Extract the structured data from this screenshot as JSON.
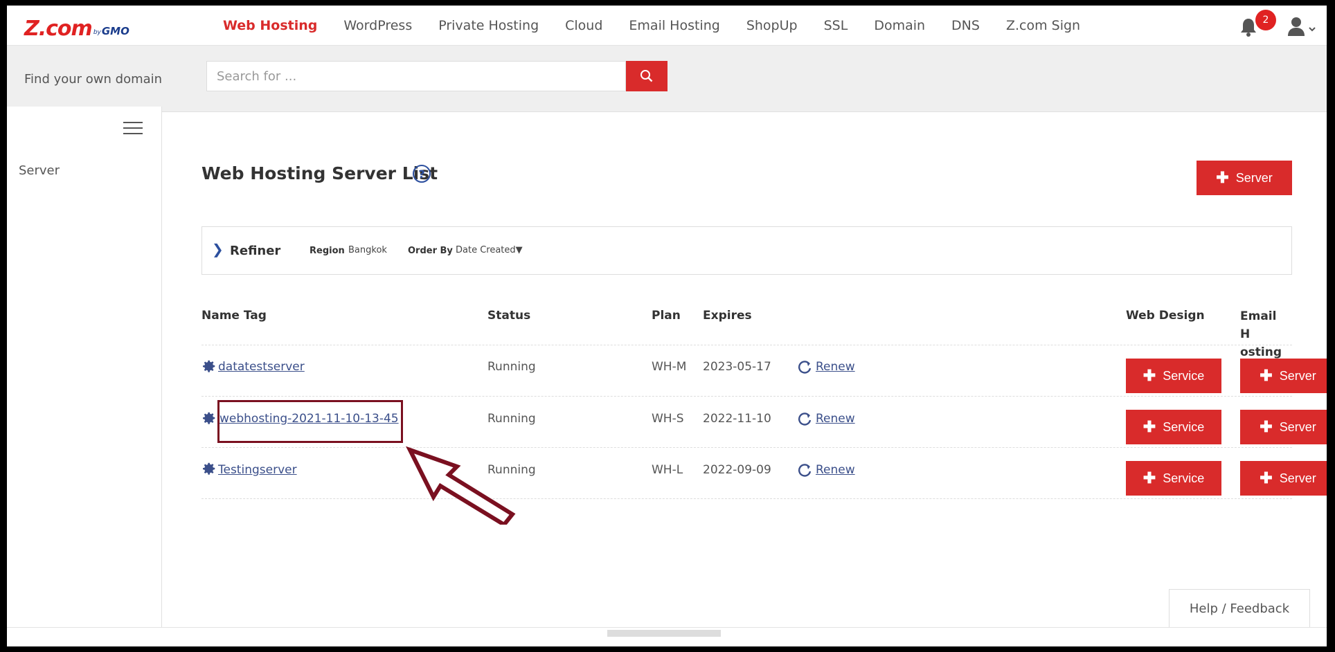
{
  "header": {
    "logo": {
      "main": "Z.com",
      "by": "by",
      "gmo": "GMO"
    },
    "nav": [
      {
        "label": "Web Hosting",
        "active": true
      },
      {
        "label": "WordPress",
        "active": false
      },
      {
        "label": "Private Hosting",
        "active": false
      },
      {
        "label": "Cloud",
        "active": false
      },
      {
        "label": "Email Hosting",
        "active": false
      },
      {
        "label": "ShopUp",
        "active": false
      },
      {
        "label": "SSL",
        "active": false
      },
      {
        "label": "Domain",
        "active": false
      },
      {
        "label": "DNS",
        "active": false
      },
      {
        "label": "Z.com Sign",
        "active": false
      }
    ],
    "notification_count": "2",
    "icons": [
      "bell-icon",
      "user-icon",
      "chevron-down-icon"
    ]
  },
  "search": {
    "label": "Find your own domain",
    "placeholder": "Search for ...",
    "button_icon": "search-icon"
  },
  "sidebar": {
    "menu_icon": "hamburger-icon",
    "items": [
      {
        "label": "Server"
      }
    ]
  },
  "main": {
    "title": "Web Hosting Server List",
    "help_icon": "?",
    "add_server_label": "Server",
    "refiner": {
      "label": "Refiner",
      "region_label": "Region",
      "region_value": "Bangkok",
      "order_label": "Order By",
      "order_value": "Date Created▼"
    },
    "table": {
      "columns": {
        "name_tag": "Name Tag",
        "status": "Status",
        "plan": "Plan",
        "expires": "Expires",
        "web_design": "Web Design",
        "email_hosting": "Email H osting"
      },
      "rows": [
        {
          "name": " datatestserver",
          "status": "Running",
          "plan": "WH-M",
          "expires": "2023-05-17",
          "renew": "Renew",
          "web_design_btn": "Service",
          "email_btn": "Server"
        },
        {
          "name": "webhosting-2021-11-10-13-45",
          "status": "Running",
          "plan": "WH-S",
          "expires": "2022-11-10",
          "renew": "Renew",
          "web_design_btn": "Service",
          "email_btn": "Server"
        },
        {
          "name": " Testingserver",
          "status": "Running",
          "plan": "WH-L",
          "expires": "2022-09-09",
          "renew": "Renew",
          "web_design_btn": "Service",
          "email_btn": "Server"
        }
      ]
    }
  },
  "annotation": {
    "highlight_color": "#7a1020"
  },
  "help_feedback": "Help / Feedback",
  "colors": {
    "brand_red": "#d92b2b",
    "link_blue": "#3b4f8a",
    "annotation": "#7a1020"
  }
}
